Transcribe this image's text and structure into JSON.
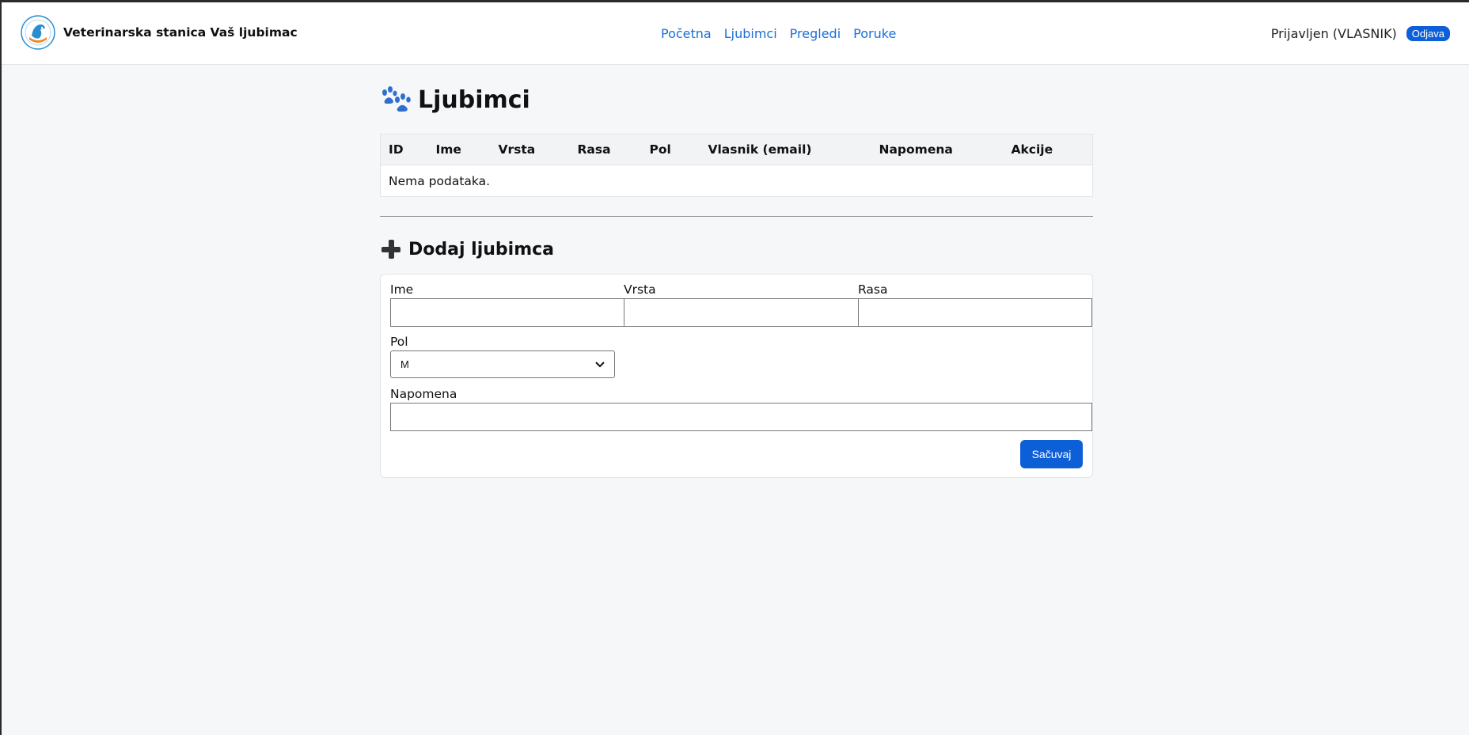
{
  "header": {
    "brand_name": "Veterinarska stanica Vaš ljubimac",
    "logo_icon": "veterinary-clinic-logo",
    "nav": [
      {
        "label": "Početna"
      },
      {
        "label": "Ljubimci"
      },
      {
        "label": "Pregledi"
      },
      {
        "label": "Poruke"
      }
    ],
    "user_status": "Prijavljen (VLASNIK)",
    "logout_label": "Odjava"
  },
  "page": {
    "title": "Ljubimci",
    "title_icon": "paw-icon"
  },
  "table": {
    "columns": [
      "ID",
      "Ime",
      "Vrsta",
      "Rasa",
      "Pol",
      "Vlasnik (email)",
      "Napomena",
      "Akcije"
    ],
    "empty_message": "Nema podataka."
  },
  "form": {
    "title": "Dodaj ljubimca",
    "title_icon": "plus-icon",
    "fields": {
      "ime": {
        "label": "Ime",
        "value": ""
      },
      "vrsta": {
        "label": "Vrsta",
        "value": ""
      },
      "rasa": {
        "label": "Rasa",
        "value": ""
      },
      "pol": {
        "label": "Pol",
        "selected": "M"
      },
      "napomena": {
        "label": "Napomena",
        "value": ""
      }
    },
    "save_label": "Sačuvaj"
  },
  "colors": {
    "accent": "#0d5fd8",
    "link": "#1a6fd6",
    "background": "#f6f7f9"
  }
}
